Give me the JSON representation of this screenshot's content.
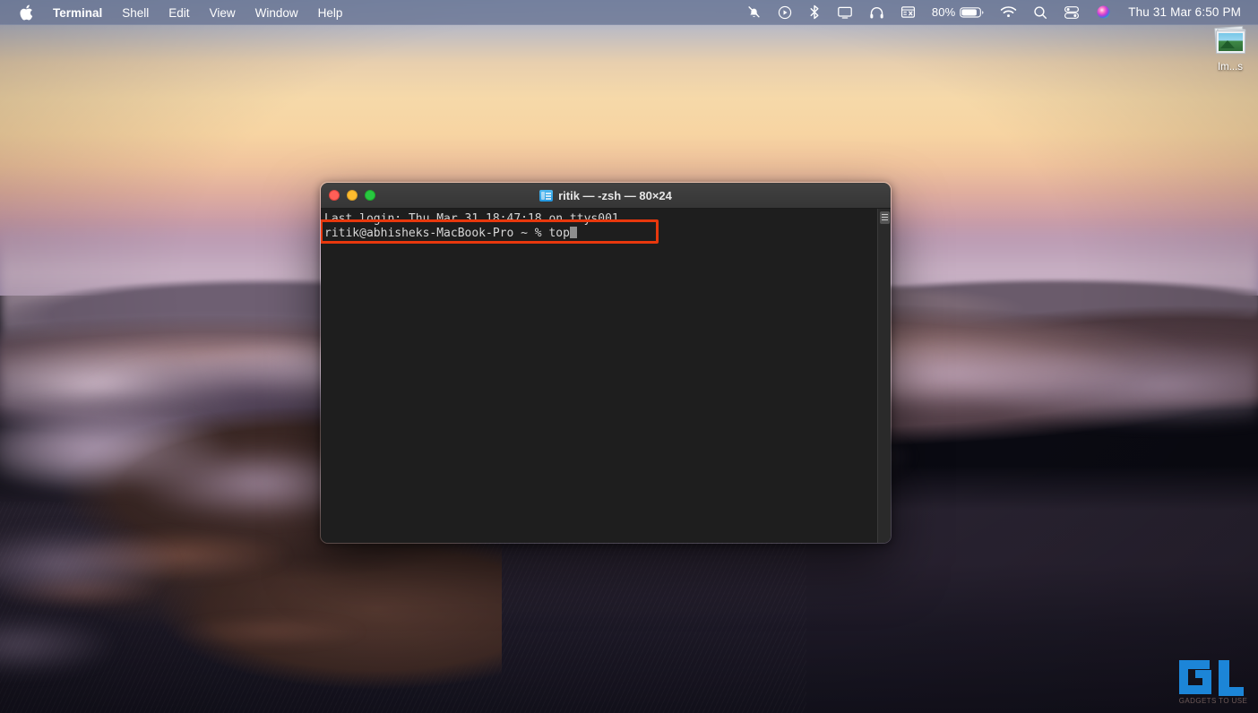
{
  "menubar": {
    "apple_icon": "apple-logo-icon",
    "items": [
      {
        "label": "Terminal",
        "bold": true
      },
      {
        "label": "Shell",
        "bold": false
      },
      {
        "label": "Edit",
        "bold": false
      },
      {
        "label": "View",
        "bold": false
      },
      {
        "label": "Window",
        "bold": false
      },
      {
        "label": "Help",
        "bold": false
      }
    ],
    "status": {
      "icons": [
        "do-not-disturb-icon",
        "play-circle-icon",
        "bluetooth-icon",
        "screen-mirroring-icon",
        "headphones-icon",
        "stocks-icon"
      ],
      "battery_percent": "80%",
      "battery_icon": "battery-icon",
      "wifi_icon": "wifi-icon",
      "search_icon": "search-icon",
      "control_center_icon": "control-center-icon",
      "siri_icon": "siri-icon",
      "clock": "Thu 31 Mar  6:50 PM"
    }
  },
  "desktop": {
    "icon": {
      "name": "images-stack-icon",
      "label": "Im...s"
    },
    "watermark": {
      "logo": "gt-logo",
      "text": "GADGETS TO USE",
      "color": "#1d8fe8"
    }
  },
  "terminal": {
    "title": "ritik — -zsh — 80×24",
    "title_icon": "folder-icon",
    "traffic_lights": [
      {
        "name": "close-button",
        "color": "#ff5f57"
      },
      {
        "name": "minimize-button",
        "color": "#febc2e"
      },
      {
        "name": "maximize-button",
        "color": "#28c840"
      }
    ],
    "lines": {
      "login": "Last login: Thu Mar 31 18:47:18 on ttys001",
      "prompt": "ritik@abhisheks-MacBook-Pro ~ % top"
    },
    "highlight_color": "#e8380d",
    "scrollbar": "vertical-scrollbar"
  }
}
